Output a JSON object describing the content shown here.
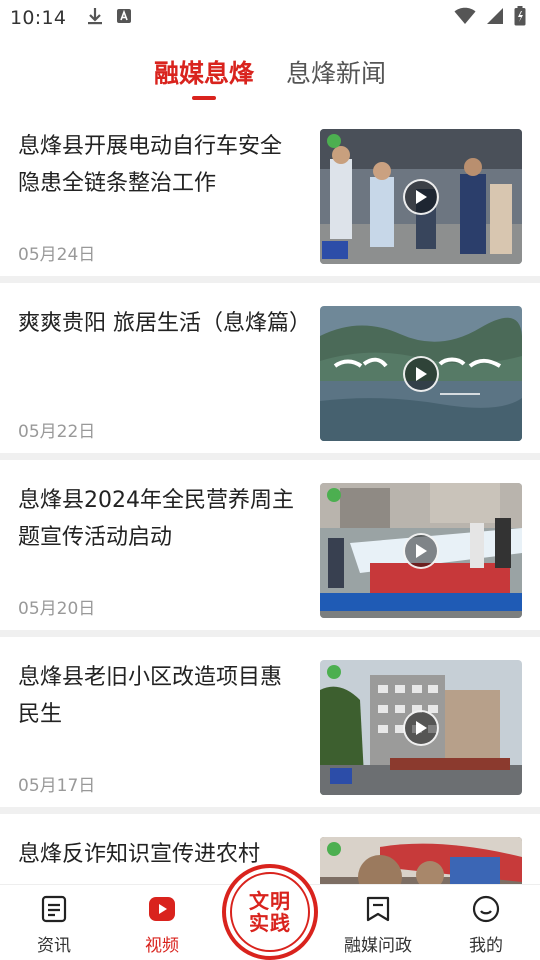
{
  "status_bar": {
    "time": "10:14",
    "icons": [
      "download-icon",
      "a-badge-icon",
      "wifi-icon",
      "signal-icon",
      "battery-icon"
    ]
  },
  "top_tabs": [
    {
      "label": "融媒息烽",
      "active": true
    },
    {
      "label": "息烽新闻",
      "active": false
    }
  ],
  "feed": [
    {
      "title": "息烽县开展电动自行车安全隐患全链条整治工作",
      "date": "05月24日",
      "thumb_icon": "play-icon"
    },
    {
      "title": "爽爽贵阳  旅居生活（息烽篇）",
      "date": "05月22日",
      "thumb_icon": "play-icon"
    },
    {
      "title": "息烽县2024年全民营养周主题宣传活动启动",
      "date": "05月20日",
      "thumb_icon": "play-icon"
    },
    {
      "title": "息烽县老旧小区改造项目惠民生",
      "date": "05月17日",
      "thumb_icon": "play-icon"
    },
    {
      "title": "息烽反诈知识宣传进农村",
      "date": "",
      "thumb_icon": "play-icon"
    }
  ],
  "bottom_nav": {
    "items": [
      {
        "label": "资讯",
        "icon": "document-icon",
        "active": false
      },
      {
        "label": "视频",
        "icon": "video-play-icon",
        "active": true
      },
      {
        "label": "融媒问政",
        "icon": "bookmark-icon",
        "active": false
      },
      {
        "label": "我的",
        "icon": "smile-icon",
        "active": false
      }
    ],
    "center": {
      "line1": "文明",
      "line2": "实践"
    }
  },
  "colors": {
    "accent": "#d9231d",
    "divider": "#f0f0f0",
    "date": "#999999"
  }
}
